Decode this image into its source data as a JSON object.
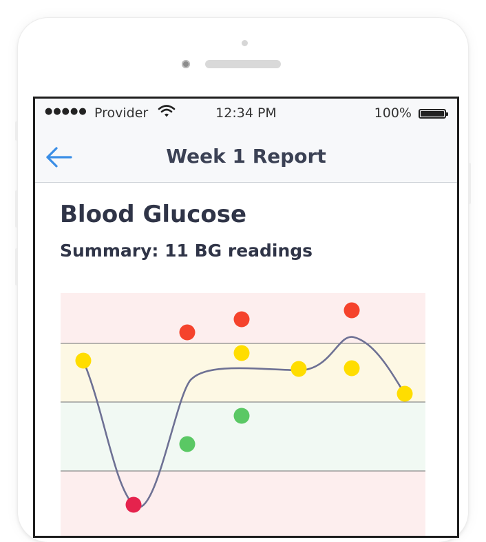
{
  "status_bar": {
    "signal": "●●●●●",
    "carrier": "Provider",
    "time": "12:34 PM",
    "battery": "100%"
  },
  "nav": {
    "title": "Week 1 Report",
    "back_icon": "arrow-left-icon"
  },
  "section": {
    "title": "Blood Glucose",
    "summary": "Summary: 11 BG readings"
  },
  "colors": {
    "accent": "#3a8ee6",
    "high": "#f5432c",
    "elevated": "#ffdd00",
    "in_range": "#5ac864",
    "low": "#e5234d",
    "trend_line": "#6e7194"
  },
  "chart_data": {
    "type": "scatter",
    "bands": [
      "high",
      "elevated",
      "in_range",
      "low"
    ],
    "x": [
      1,
      2,
      2,
      3,
      3,
      3,
      4,
      5,
      5,
      6
    ],
    "readings": [
      {
        "x": 1,
        "zone": "elevated"
      },
      {
        "x": 2,
        "zone": "low"
      },
      {
        "x": 3,
        "zone": "high"
      },
      {
        "x": 3,
        "zone": "in_range"
      },
      {
        "x": 4,
        "zone": "high"
      },
      {
        "x": 4,
        "zone": "elevated"
      },
      {
        "x": 4,
        "zone": "in_range"
      },
      {
        "x": 5,
        "zone": "elevated"
      },
      {
        "x": 6,
        "zone": "high"
      },
      {
        "x": 6,
        "zone": "elevated"
      },
      {
        "x": 7,
        "zone": "elevated"
      }
    ],
    "trend_line": true
  }
}
